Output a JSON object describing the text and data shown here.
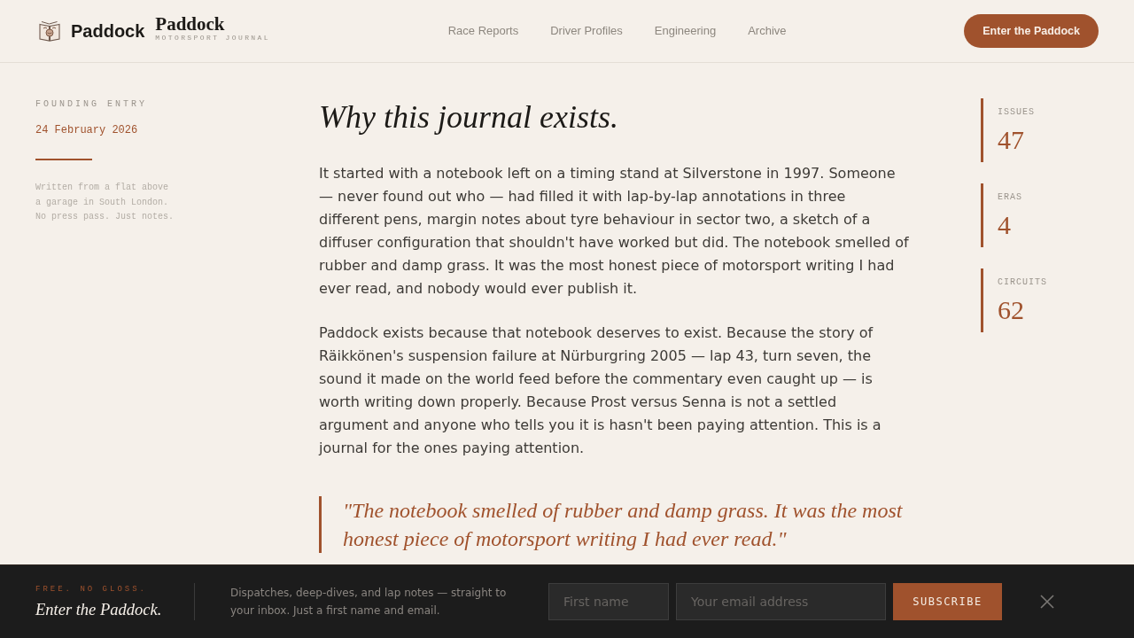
{
  "header": {
    "brand": "Paddock",
    "masthead": {
      "title": "Paddock",
      "subtitle": "MOTORSPORT JOURNAL"
    },
    "nav": [
      "Race Reports",
      "Driver Profiles",
      "Engineering",
      "Archive"
    ],
    "cta": "Enter the Paddock"
  },
  "sidebar": {
    "label": "FOUNDING ENTRY",
    "date": "24 February 2026",
    "note": "Written from a flat above a garage in South London. No press pass. Just notes."
  },
  "article": {
    "title": "Why this journal exists.",
    "paragraphs": [
      "It started with a notebook left on a timing stand at Silverstone in 1997. Someone — never found out who — had filled it with lap-by-lap annotations in three different pens, margin notes about tyre behaviour in sector two, a sketch of a diffuser configuration that shouldn't have worked but did. The notebook smelled of rubber and damp grass. It was the most honest piece of motorsport writing I had ever read, and nobody would ever publish it.",
      "Paddock exists because that notebook deserves to exist. Because the story of Räikkönen's suspension failure at Nürburgring 2005 — lap 43, turn seven, the sound it made on the world feed before the commentary even caught up — is worth writing down properly. Because Prost versus Senna is not a settled argument and anyone who tells you it is hasn't been paying attention. This is a journal for the ones paying attention."
    ],
    "pull_quote": "\"The notebook smelled of rubber and damp grass. It was the most honest piece of motorsport writing I had ever read.\""
  },
  "stats": [
    {
      "label": "ISSUES",
      "value": "47"
    },
    {
      "label": "ERAS",
      "value": "4"
    },
    {
      "label": "CIRCUITS",
      "value": "62"
    }
  ],
  "newsletter": {
    "eyebrow": "FREE. NO GLOSS.",
    "title": "Enter the Paddock.",
    "description": "Dispatches, deep-dives, and lap notes — straight to your inbox. Just a first name and email.",
    "fields": [
      {
        "placeholder": "First name",
        "kind": "name"
      },
      {
        "placeholder": "Your email address",
        "kind": "email"
      }
    ],
    "button": "SUBSCRIBE"
  }
}
